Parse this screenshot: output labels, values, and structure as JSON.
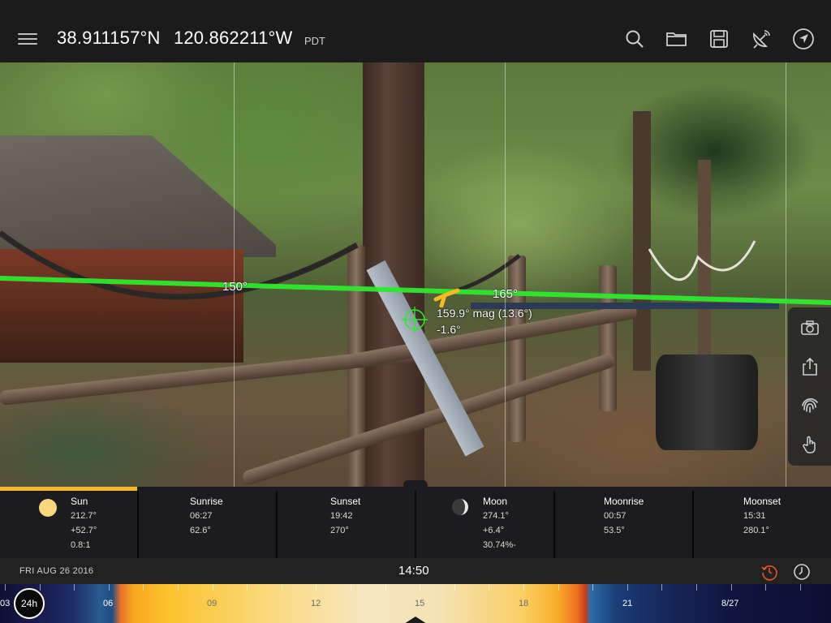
{
  "header": {
    "latitude": "38.911157°N",
    "longitude": "120.862211°W",
    "timezone": "PDT",
    "icons": [
      "menu-icon",
      "search-icon",
      "folder-icon",
      "save-icon",
      "satellite-dish-icon",
      "navigation-arrow-icon"
    ]
  },
  "camera": {
    "azimuth_labels": [
      "150°",
      "165°"
    ],
    "readout_line1": "159.9° mag (13.6°)",
    "readout_line2": "-1.6°",
    "colors": {
      "horizon_line": "#2ee82e",
      "sun_marker": "#f6b926",
      "reticle": "#2ee82e"
    }
  },
  "side_panel": {
    "icons": [
      "camera-icon",
      "share-icon",
      "fingerprint-icon",
      "hand-pointer-icon"
    ]
  },
  "info": {
    "sun": {
      "title": "Sun",
      "azimuth": "212.7°",
      "elevation": "+52.7°",
      "shadow": "0.8:1"
    },
    "sunrise": {
      "title": "Sunrise",
      "time": "06:27",
      "azimuth": "62.6°"
    },
    "sunset": {
      "title": "Sunset",
      "time": "19:42",
      "azimuth": "270°"
    },
    "moon": {
      "title": "Moon",
      "azimuth": "274.1°",
      "elevation": "+6.4°",
      "illumination": "30.74%-"
    },
    "moonrise": {
      "title": "Moonrise",
      "time": "00:57",
      "azimuth": "53.5°"
    },
    "moonset": {
      "title": "Moonset",
      "time": "15:31",
      "azimuth": "280.1°"
    }
  },
  "date_bar": {
    "date": "FRI AUG 26 2016",
    "time": "14:50",
    "icons": [
      "reset-time-icon",
      "clock-icon"
    ],
    "colors": {
      "reset_icon": "#e0562b",
      "clock_icon": "#cfcfcf"
    }
  },
  "timeline": {
    "mode_button": "24h",
    "labels": [
      "03",
      "06",
      "09",
      "12",
      "15",
      "18",
      "21",
      "8/27"
    ]
  }
}
